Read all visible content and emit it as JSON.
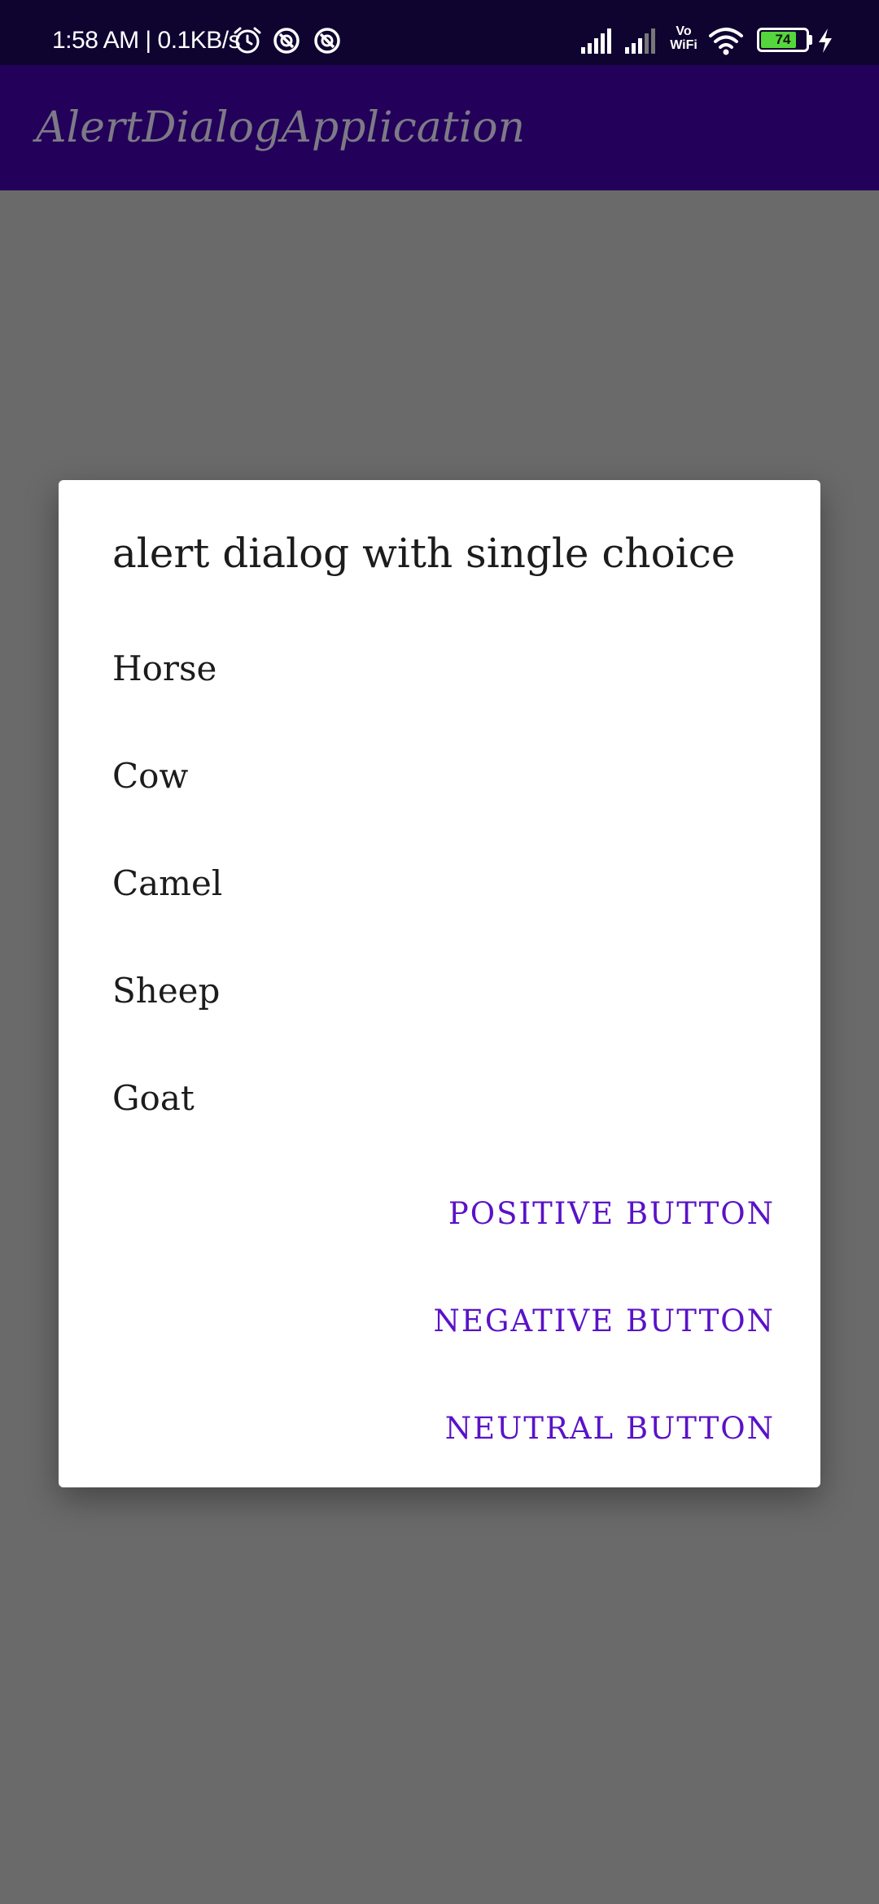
{
  "status_bar": {
    "time_and_speed": "1:58 AM | 0.1KB/s",
    "network_label": "Vo WiFi",
    "battery_level": "74",
    "icons": [
      "alarm-icon",
      "sync-icon",
      "sync-icon",
      "signal-icon",
      "signal-icon",
      "vowifi-icon",
      "wifi-icon",
      "battery-icon",
      "charging-icon"
    ]
  },
  "app_bar": {
    "title": "AlertDialogApplication"
  },
  "dialog": {
    "title": "alert dialog with single choice",
    "choices": [
      "Horse",
      "Cow",
      "Camel",
      "Sheep",
      "Goat"
    ],
    "buttons": {
      "positive": "POSITIVE BUTTON",
      "negative": "NEGATIVE BUTTON",
      "neutral": "NEUTRAL BUTTON"
    }
  },
  "colors": {
    "status_bar": "#0f0330",
    "app_bar": "#23015a",
    "scrim_background": "#6a6a6a",
    "dialog_background": "#ffffff",
    "button_text": "#5a12c8",
    "battery_fill": "#55d63c"
  }
}
